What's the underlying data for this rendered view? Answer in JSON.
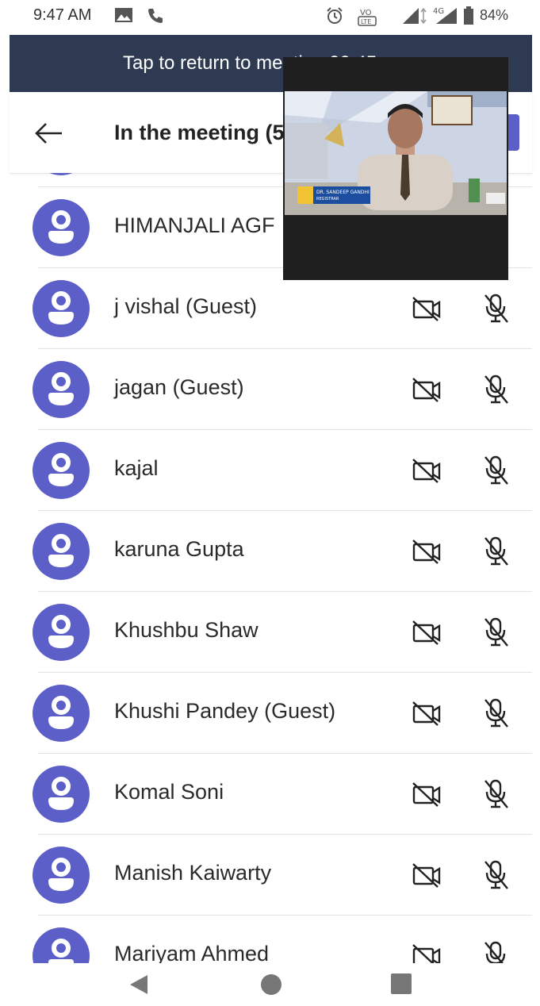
{
  "status_bar": {
    "time": "9:47 AM",
    "battery": "84%",
    "icons": [
      "image-icon",
      "phone-icon",
      "alarm-icon",
      "volte-icon",
      "signal-icon",
      "4g-signal-icon",
      "battery-icon"
    ]
  },
  "banner": {
    "text": "Tap to return to meeting 00:45"
  },
  "header": {
    "title": "In the meeting (5"
  },
  "participants": [
    {
      "name": "HIMANJALI AGF"
    },
    {
      "name": "j vishal (Guest)"
    },
    {
      "name": "jagan (Guest)"
    },
    {
      "name": "kajal"
    },
    {
      "name": "karuna Gupta"
    },
    {
      "name": "Khushbu Shaw"
    },
    {
      "name": "Khushi Pandey (Guest)"
    },
    {
      "name": "Komal Soni"
    },
    {
      "name": "Manish Kaiwarty"
    },
    {
      "name": "Mariyam Ahmed"
    }
  ],
  "pip": {
    "lower_third_name": "DR. SANDEEP GANDHI",
    "lower_third_role": "REGISTRAR"
  },
  "colors": {
    "accent": "#5b5fc7",
    "banner": "#2e3a52"
  }
}
